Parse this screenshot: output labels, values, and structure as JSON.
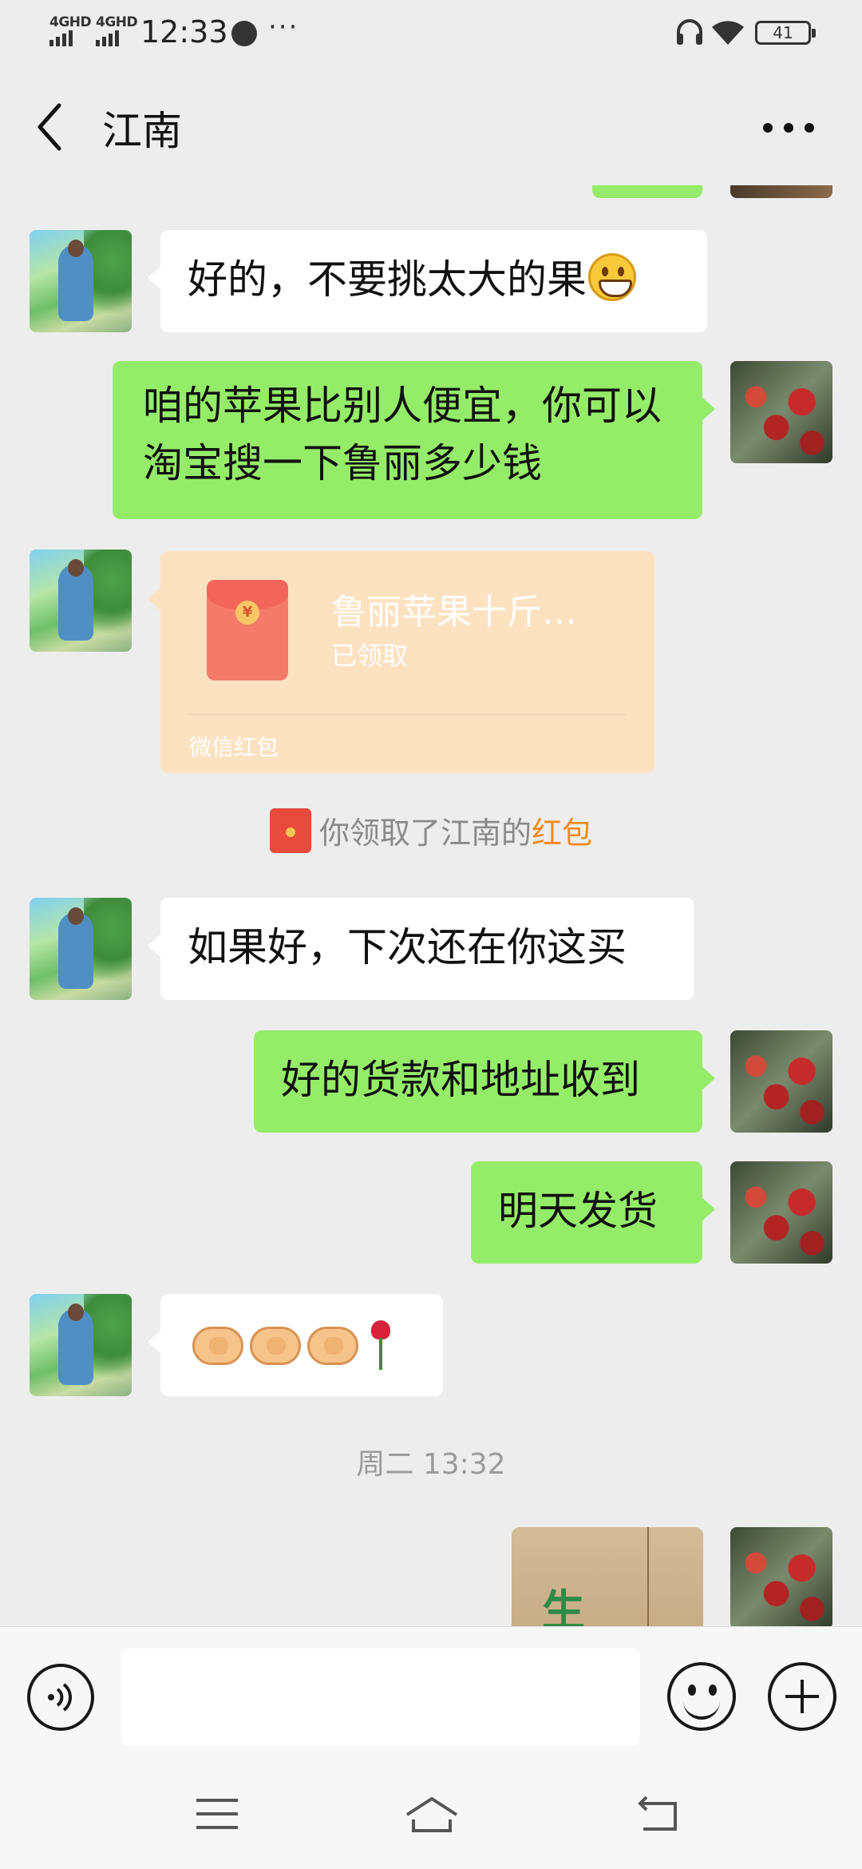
{
  "status_bar": {
    "signal_1": "4GHD",
    "signal_2": "4GHD",
    "time": "12:33",
    "more": "···",
    "battery": "41"
  },
  "header": {
    "title": "江南"
  },
  "messages": [
    {
      "side": "in",
      "text": "好的，不要挑太大的果",
      "emoji": "grin-icon"
    },
    {
      "side": "out",
      "text": "咱的苹果比别人便宜，你可以淘宝搜一下鲁丽多少钱"
    },
    {
      "side": "in",
      "type": "red_packet",
      "title": "鲁丽苹果十斤…",
      "status": "已领取",
      "footer": "微信红包"
    },
    {
      "type": "system",
      "prefix": "你领取了江南的",
      "highlight": "红包"
    },
    {
      "side": "in",
      "text": "如果好，下次还在你这买"
    },
    {
      "side": "out",
      "text": "好的货款和地址收到"
    },
    {
      "side": "out",
      "text": "明天发货"
    },
    {
      "side": "in",
      "emojis": [
        "handshake-icon",
        "handshake-icon",
        "handshake-icon",
        "rose-icon"
      ]
    },
    {
      "type": "timestamp",
      "text": "周二 13:32"
    },
    {
      "side": "out",
      "type": "image",
      "visible_glyph": "生"
    }
  ],
  "input_bar": {
    "value": "",
    "placeholder": ""
  },
  "colors": {
    "background": "#ededed",
    "bubble_out": "#95ec69",
    "bubble_in": "#ffffff",
    "red_packet": "#fde2c2",
    "highlight": "#f08a1d"
  }
}
